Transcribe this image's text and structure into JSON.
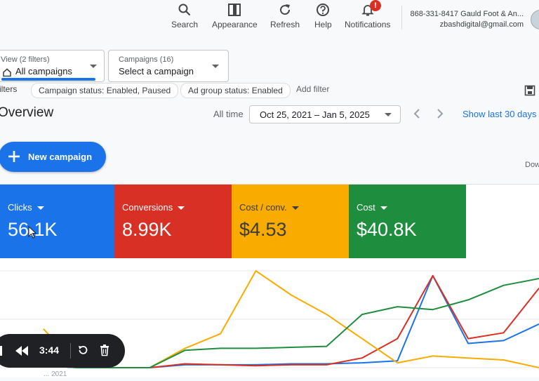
{
  "toolbar": {
    "search_label": "Search",
    "appearance_label": "Appearance",
    "refresh_label": "Refresh",
    "help_label": "Help",
    "notifications_label": "Notifications",
    "notifications_badge": "!"
  },
  "account": {
    "line1": "868-331-8417 Gauld Foot & An...",
    "email": "zbashdigital@gmail.com"
  },
  "filters": {
    "view": {
      "caption": "View (2 filters)",
      "value": "All campaigns"
    },
    "campaigns": {
      "caption": "Campaigns (16)",
      "value": "Select a campaign"
    },
    "prefix": "ilters",
    "chips": [
      "Campaign status: Enabled, Paused",
      "Ad group status: Enabled"
    ],
    "add_filter": "Add filter"
  },
  "overview": {
    "title": "Overview",
    "all_time": "All time",
    "date_range": "Oct 25, 2021 – Jan 5, 2025",
    "show_last": "Show last 30 days",
    "new_campaign": "New campaign",
    "download_partial": "Dow"
  },
  "metrics": [
    {
      "label": "Clicks",
      "value": "56.1K",
      "color": "#1a73e8"
    },
    {
      "label": "Conversions",
      "value": "8.99K",
      "color": "#d93025"
    },
    {
      "label": "Cost / conv.",
      "value": "$4.53",
      "color": "#f9ab00"
    },
    {
      "label": "Cost",
      "value": "$40.8K",
      "color": "#1e8e3e"
    }
  ],
  "chart_data": {
    "type": "line",
    "x_label_partial": "... 2021",
    "grid": true,
    "series": [
      {
        "color": "#1a73e8",
        "values": [
          0.02,
          0.0,
          0.0,
          0.0,
          0.03,
          0.03,
          0.03,
          0.04,
          0.04,
          0.05,
          0.07,
          0.95,
          0.25,
          0.28,
          0.45
        ]
      },
      {
        "color": "#d93025",
        "values": [
          0.02,
          0.0,
          0.0,
          0.0,
          0.04,
          0.03,
          0.02,
          0.03,
          0.03,
          0.1,
          0.3,
          0.95,
          0.3,
          0.36,
          0.82
        ]
      },
      {
        "color": "#f9ab00",
        "values": [
          0.4,
          0.0,
          0.0,
          0.0,
          0.2,
          0.35,
          1.0,
          0.75,
          0.55,
          0.3,
          0.05,
          0.12,
          0.1,
          0.08,
          0.0
        ]
      },
      {
        "color": "#1e8e3e",
        "values": [
          0.02,
          0.0,
          0.0,
          0.0,
          0.18,
          0.2,
          0.2,
          0.21,
          0.22,
          0.55,
          0.63,
          0.6,
          0.7,
          0.85,
          0.92
        ]
      }
    ]
  },
  "player": {
    "time": "3:44"
  }
}
